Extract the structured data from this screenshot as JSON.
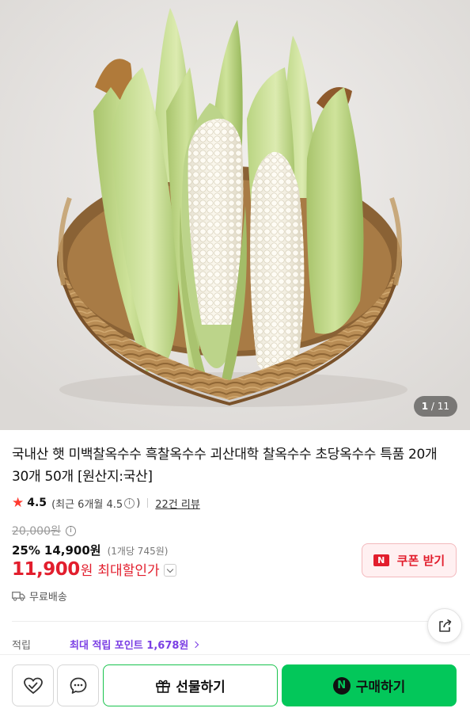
{
  "product_image": {
    "subject": "corn-in-basket",
    "page_current": "1",
    "page_sep": " / ",
    "page_total": "11"
  },
  "product": {
    "title": "국내산 햇 미백찰옥수수 흑찰옥수수 괴산대학 찰옥수수 초당옥수수 특품 20개 30개 50개 [원산지:국산]"
  },
  "rating": {
    "score": "4.5",
    "recent_text": "(최근 6개월 4.5",
    "recent_close": ")",
    "reviews_link": "22건 리뷰"
  },
  "price": {
    "original": "20,000원",
    "discount_pct": "25%",
    "sale_price": "14,900원",
    "unit_price": "(1개당 745원)",
    "max_discount_price": "11,900",
    "max_discount_unit": "원",
    "max_discount_label": "최대할인가"
  },
  "coupon": {
    "badge": "N",
    "label": "쿠폰 받기"
  },
  "shipping": {
    "label": "무료배송"
  },
  "points": {
    "label": "적립",
    "text": "최대 적립 포인트 1,678원"
  },
  "bottom_bar": {
    "gift_label": "선물하기",
    "buy_badge": "N",
    "buy_label": "구매하기"
  },
  "colors": {
    "sale_red": "#e21e2d",
    "naver_green": "#03c75a",
    "points_purple": "#7b3fe4"
  }
}
